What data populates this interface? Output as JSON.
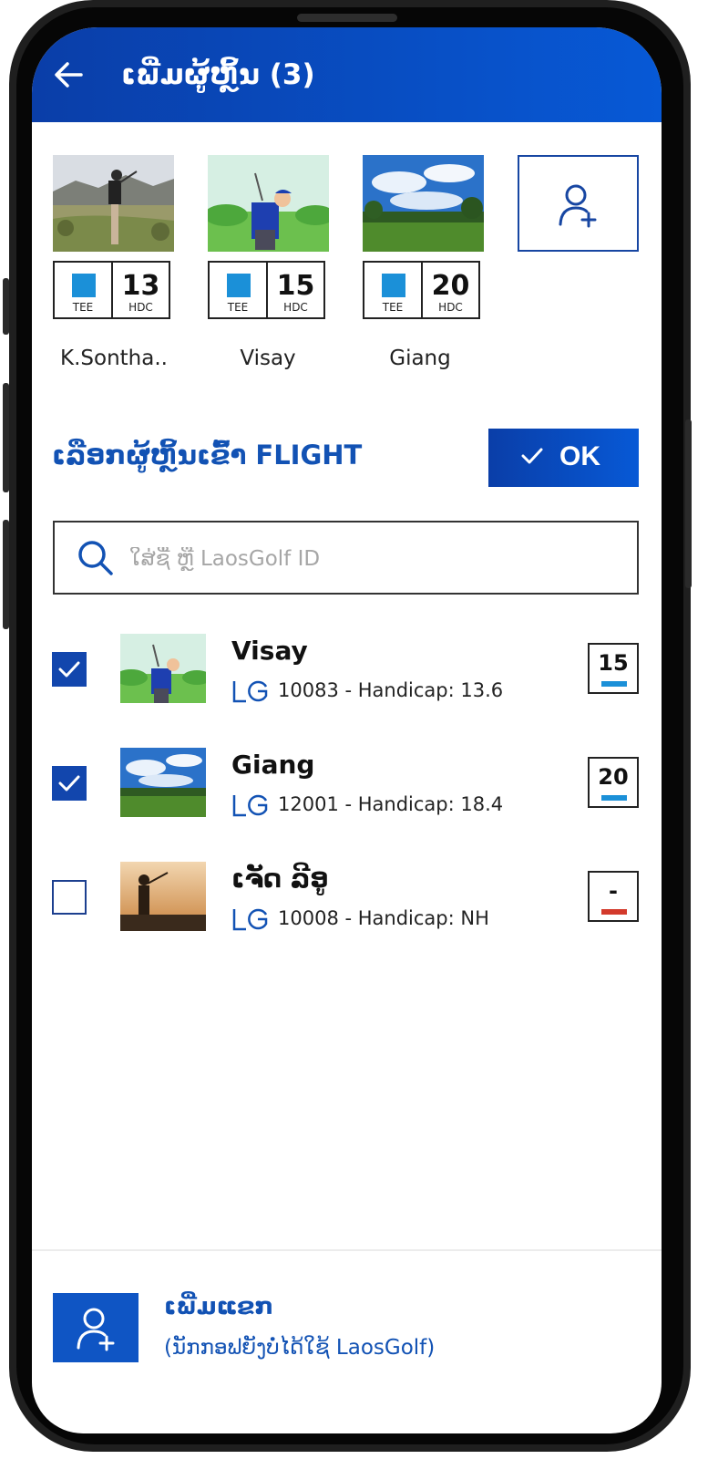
{
  "header": {
    "title": "ເພີ່ມຜູ້ຫຼິ້ນ (3)"
  },
  "selected_players": [
    {
      "name": "K.Sontha..",
      "tee_label": "TEE",
      "hdc": "13",
      "hdc_label": "HDC",
      "tee_color": "#1b90d8"
    },
    {
      "name": "Visay",
      "tee_label": "TEE",
      "hdc": "15",
      "hdc_label": "HDC",
      "tee_color": "#1b90d8"
    },
    {
      "name": "Giang",
      "tee_label": "TEE",
      "hdc": "20",
      "hdc_label": "HDC",
      "tee_color": "#1b90d8"
    }
  ],
  "flight": {
    "title": "ເລືອກຜູ້ຫຼິ້ນເຂົ້າ FLIGHT",
    "ok_label": "OK"
  },
  "search": {
    "placeholder": "ໃສ່ຊື່ ຫຼື LaosGolf ID"
  },
  "players": [
    {
      "name": "Visay",
      "info": "10083 - Handicap: 13.6",
      "hdc": "15",
      "bar_color": "#1b90d8",
      "checked": true
    },
    {
      "name": "Giang",
      "info": "12001 - Handicap: 18.4",
      "hdc": "20",
      "bar_color": "#1b90d8",
      "checked": true
    },
    {
      "name": "ເຈັດ ລີອູ",
      "info": "10008 - Handicap: NH",
      "hdc": "-",
      "bar_color": "#d33a2c",
      "checked": false
    }
  ],
  "guest": {
    "title": "ເພີ່ມແຂກ",
    "subtitle": "(ນັກກອຟຍັງບໍ່ໄດ້ໃຊ້ LaosGolf)"
  },
  "colors": {
    "primary": "#0a3ea8",
    "accent": "#1252b4",
    "tee_blue": "#1b90d8",
    "red": "#d33a2c"
  }
}
